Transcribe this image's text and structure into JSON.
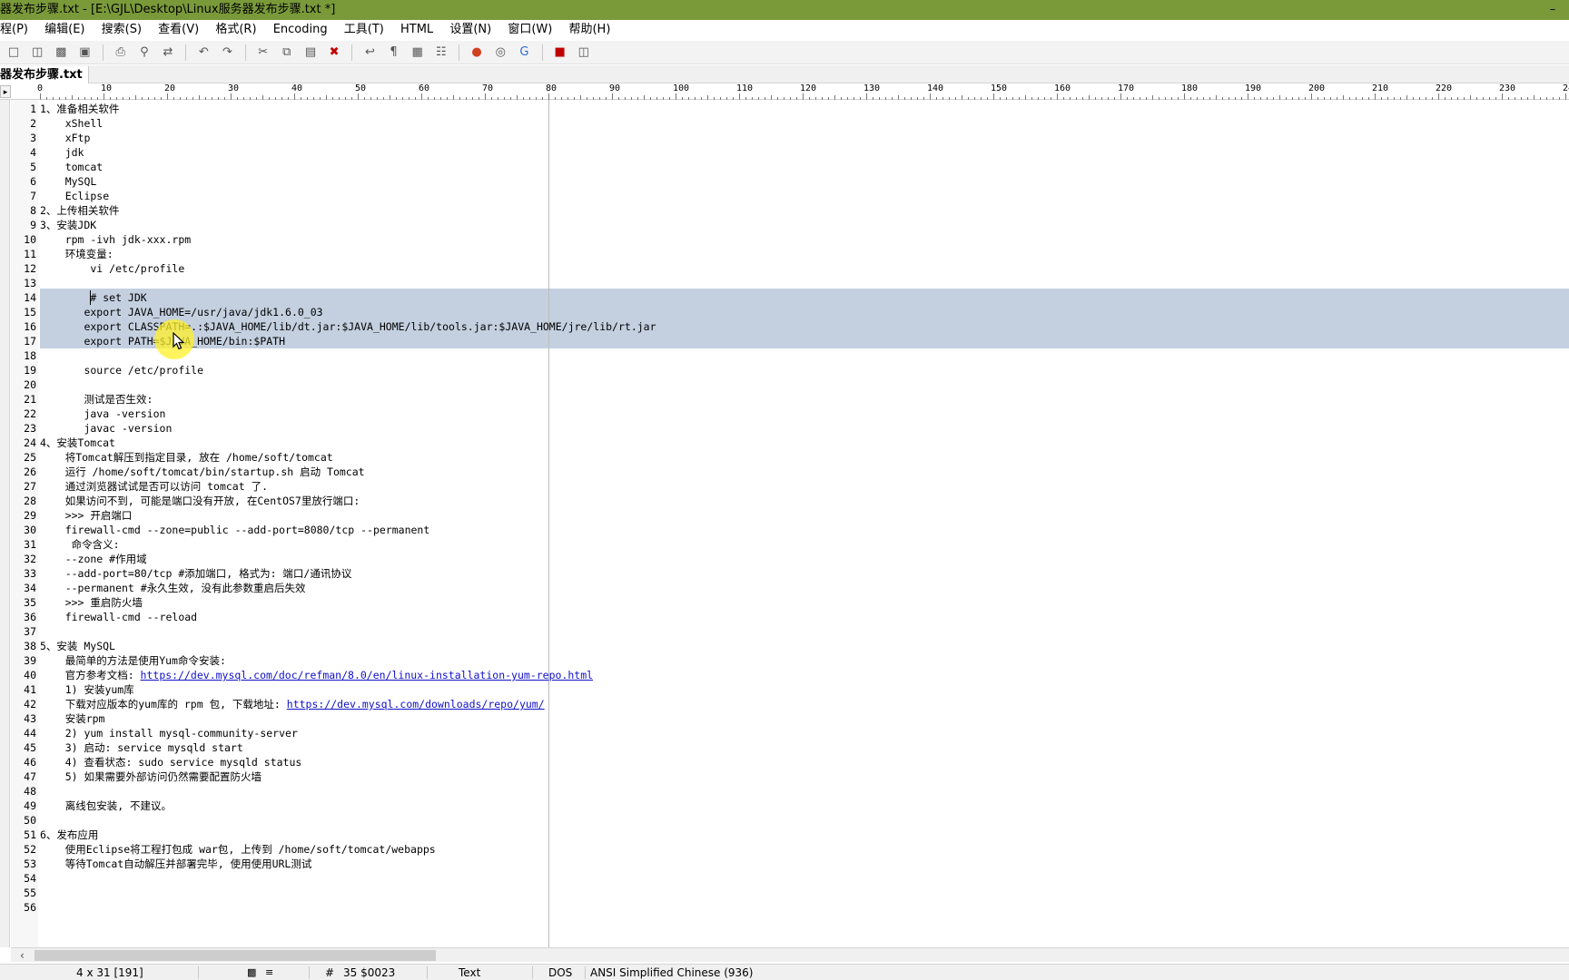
{
  "window": {
    "title": "器发布步骤.txt - [E:\\GJL\\Desktop\\Linux服务器发布步骤.txt *]",
    "minimize_glyph": "–"
  },
  "menu": [
    "程(P)",
    "编辑(E)",
    "搜索(S)",
    "查看(V)",
    "格式(R)",
    "Encoding",
    "工具(T)",
    "HTML",
    "设置(N)",
    "窗口(W)",
    "帮助(H)"
  ],
  "toolbar": {
    "icons": [
      "new-file-icon",
      "open-icon",
      "save-icon",
      "save-all-icon",
      "print-icon",
      "find-icon",
      "replace-icon",
      "undo-icon",
      "redo-icon",
      "cut-icon",
      "copy-icon",
      "paste-icon",
      "delete-icon",
      "word-wrap-icon",
      "show-spaces-icon",
      "column-mode-icon",
      "hex-icon",
      "color-icon",
      "browser-icon",
      "google-icon",
      "macro-icon",
      "compare-icon"
    ]
  },
  "tab": {
    "label": "器发布步骤.txt"
  },
  "ruler": {
    "labels": [
      "0",
      "10",
      "20",
      "30",
      "40",
      "50",
      "60",
      "70",
      "80",
      "90",
      "100",
      "110",
      "120",
      "130",
      "140",
      "150",
      "160",
      "170",
      "180",
      "190",
      "200",
      "210",
      "220",
      "230",
      "24"
    ]
  },
  "editor": {
    "lines": [
      {
        "n": "1",
        "segments": [
          {
            "text": "1、准备相关软件"
          }
        ]
      },
      {
        "n": "2",
        "segments": [
          {
            "text": "    xShell"
          }
        ]
      },
      {
        "n": "3",
        "segments": [
          {
            "text": "    xFtp"
          }
        ]
      },
      {
        "n": "4",
        "segments": [
          {
            "text": "    jdk"
          }
        ]
      },
      {
        "n": "5",
        "segments": [
          {
            "text": "    tomcat"
          }
        ]
      },
      {
        "n": "6",
        "segments": [
          {
            "text": "    MySQL"
          }
        ]
      },
      {
        "n": "7",
        "segments": [
          {
            "text": "    Eclipse"
          }
        ]
      },
      {
        "n": "8",
        "segments": [
          {
            "text": "2、上传相关软件"
          }
        ]
      },
      {
        "n": "9",
        "segments": [
          {
            "text": "3、安装JDK"
          }
        ]
      },
      {
        "n": "10",
        "segments": [
          {
            "text": "    rpm -ivh jdk-xxx.rpm"
          }
        ]
      },
      {
        "n": "11",
        "segments": [
          {
            "text": "    环境变量:"
          }
        ]
      },
      {
        "n": "12",
        "segments": [
          {
            "text": "        vi /etc/profile"
          }
        ]
      },
      {
        "n": "13",
        "segments": [
          {
            "text": ""
          }
        ]
      },
      {
        "n": "14",
        "segments": [
          {
            "text": "        # set JDK"
          }
        ]
      },
      {
        "n": "15",
        "segments": [
          {
            "text": "       export JAVA_HOME=/usr/java/jdk1.6.0_03"
          }
        ]
      },
      {
        "n": "16",
        "segments": [
          {
            "text": "       export CLASSPATH=.:$JAVA_HOME/lib/dt.jar:$JAVA_HOME/lib/tools.jar:$JAVA_HOME/jre/lib/rt.jar"
          }
        ]
      },
      {
        "n": "17",
        "segments": [
          {
            "text": "       export PATH=$JAVA_HOME/bin:$PATH"
          }
        ]
      },
      {
        "n": "18",
        "segments": [
          {
            "text": ""
          }
        ]
      },
      {
        "n": "19",
        "segments": [
          {
            "text": "       source /etc/profile"
          }
        ]
      },
      {
        "n": "20",
        "segments": [
          {
            "text": ""
          }
        ]
      },
      {
        "n": "21",
        "segments": [
          {
            "text": "       测试是否生效:"
          }
        ]
      },
      {
        "n": "22",
        "segments": [
          {
            "text": "       java -version"
          }
        ]
      },
      {
        "n": "23",
        "segments": [
          {
            "text": "       javac -version"
          }
        ]
      },
      {
        "n": "24",
        "segments": [
          {
            "text": "4、安装Tomcat"
          }
        ]
      },
      {
        "n": "25",
        "segments": [
          {
            "text": "    将Tomcat解压到指定目录, 放在 /home/soft/tomcat"
          }
        ]
      },
      {
        "n": "26",
        "segments": [
          {
            "text": "    运行 /home/soft/tomcat/bin/startup.sh 启动 Tomcat"
          }
        ]
      },
      {
        "n": "27",
        "segments": [
          {
            "text": "    通过浏览器试试是否可以访问 tomcat 了."
          }
        ]
      },
      {
        "n": "28",
        "segments": [
          {
            "text": "    如果访问不到, 可能是端口没有开放, 在CentOS7里放行端口:"
          }
        ]
      },
      {
        "n": "29",
        "segments": [
          {
            "text": "    >>> 开启端口"
          }
        ]
      },
      {
        "n": "30",
        "segments": [
          {
            "text": "    firewall-cmd --zone=public --add-port=8080/tcp --permanent"
          }
        ]
      },
      {
        "n": "31",
        "segments": [
          {
            "text": "     命令含义:"
          }
        ]
      },
      {
        "n": "32",
        "segments": [
          {
            "text": "    --zone #作用域"
          }
        ]
      },
      {
        "n": "33",
        "segments": [
          {
            "text": "    --add-port=80/tcp #添加端口, 格式为: 端口/通讯协议"
          }
        ]
      },
      {
        "n": "34",
        "segments": [
          {
            "text": "    --permanent #永久生效, 没有此参数重启后失效"
          }
        ]
      },
      {
        "n": "35",
        "segments": [
          {
            "text": "    >>> 重启防火墙"
          }
        ]
      },
      {
        "n": "36",
        "segments": [
          {
            "text": "    firewall-cmd --reload"
          }
        ]
      },
      {
        "n": "37",
        "segments": [
          {
            "text": ""
          }
        ]
      },
      {
        "n": "38",
        "segments": [
          {
            "text": "5、安装 MySQL"
          }
        ]
      },
      {
        "n": "39",
        "segments": [
          {
            "text": "    最简单的方法是使用Yum命令安装:"
          }
        ]
      },
      {
        "n": "40",
        "segments": [
          {
            "text": "    官方参考文档: "
          },
          {
            "text": "https://dev.mysql.com/doc/refman/8.0/en/linux-installation-yum-repo.html",
            "link": true
          }
        ]
      },
      {
        "n": "41",
        "segments": [
          {
            "text": "    1) 安装yum库"
          }
        ]
      },
      {
        "n": "42",
        "segments": [
          {
            "text": "    下载对应版本的yum库的 rpm 包, 下载地址: "
          },
          {
            "text": "https://dev.mysql.com/downloads/repo/yum/",
            "link": true
          }
        ]
      },
      {
        "n": "43",
        "segments": [
          {
            "text": "    安装rpm"
          }
        ]
      },
      {
        "n": "44",
        "segments": [
          {
            "text": "    2) yum install mysql-community-server"
          }
        ]
      },
      {
        "n": "45",
        "segments": [
          {
            "text": "    3) 启动: service mysqld start"
          }
        ]
      },
      {
        "n": "46",
        "segments": [
          {
            "text": "    4) 查看状态: sudo service mysqld status"
          }
        ]
      },
      {
        "n": "47",
        "segments": [
          {
            "text": "    5) 如果需要外部访问仍然需要配置防火墙"
          }
        ]
      },
      {
        "n": "48",
        "segments": [
          {
            "text": ""
          }
        ]
      },
      {
        "n": "49",
        "segments": [
          {
            "text": "    离线包安装, 不建议。"
          }
        ]
      },
      {
        "n": "50",
        "segments": [
          {
            "text": ""
          }
        ]
      },
      {
        "n": "51",
        "segments": [
          {
            "text": "6、发布应用"
          }
        ]
      },
      {
        "n": "52",
        "segments": [
          {
            "text": "    使用Eclipse将工程打包成 war包, 上传到 /home/soft/tomcat/webapps"
          }
        ]
      },
      {
        "n": "53",
        "segments": [
          {
            "text": "    等待Tomcat自动解压并部署完毕, 使用使用URL测试"
          }
        ]
      },
      {
        "n": "54",
        "segments": [
          {
            "text": ""
          }
        ]
      },
      {
        "n": "55",
        "segments": [
          {
            "text": ""
          }
        ]
      },
      {
        "n": "56",
        "segments": [
          {
            "text": ""
          }
        ]
      }
    ],
    "selection": {
      "from_line": 14,
      "to_line": 17
    },
    "cursor": {
      "line": 14,
      "column": 4
    }
  },
  "statusbar": {
    "position": "4 x 31   [191]",
    "hash": "#",
    "char_code": "35  $0023",
    "mode": "Text",
    "line_ending": "DOS",
    "encoding": "ANSI Simplified Chinese (936)"
  },
  "colors": {
    "title_bar": "#7a9a3a",
    "selection": "#c4d0e0",
    "link": "#1010c8"
  }
}
